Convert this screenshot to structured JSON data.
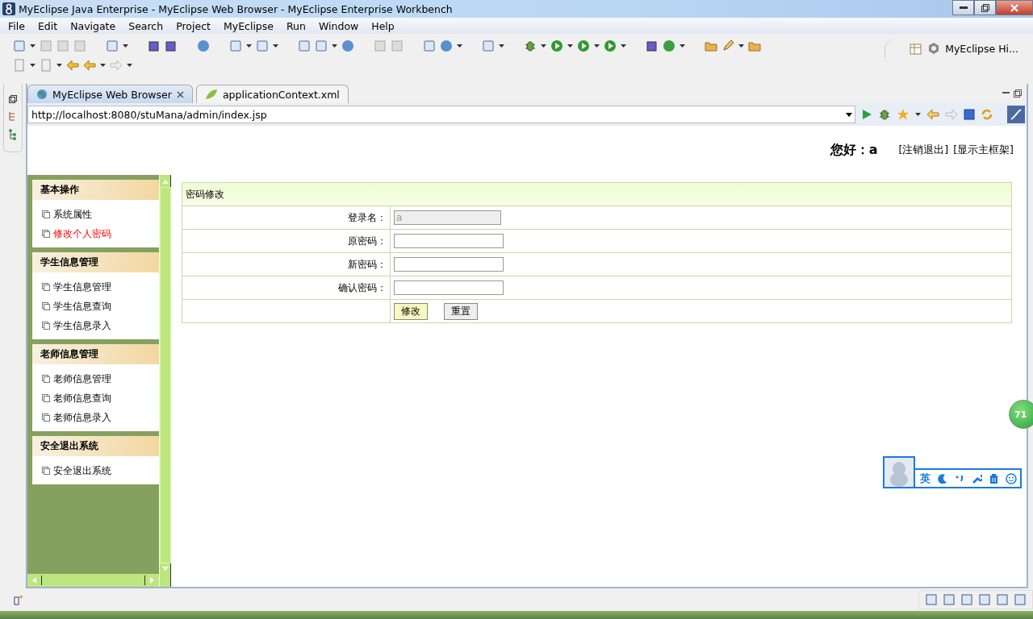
{
  "window": {
    "title": "MyEclipse Java Enterprise - MyEclipse Web Browser - MyEclipse Enterprise Workbench"
  },
  "menu": [
    "File",
    "Edit",
    "Navigate",
    "Search",
    "Project",
    "MyEclipse",
    "Run",
    "Window",
    "Help"
  ],
  "perspective": {
    "label": "MyEclipse Hi..."
  },
  "editor_tabs": [
    {
      "label": "MyEclipse Web Browser",
      "selected": true
    },
    {
      "label": "applicationContext.xml",
      "selected": false
    }
  ],
  "address": {
    "value": "http://localhost:8080/stuMana/admin/index.jsp"
  },
  "page": {
    "greeting": "您好：a",
    "links": [
      "[注销退出]",
      "[显示主框架]"
    ],
    "sidebar": [
      {
        "title": "基本操作",
        "items": [
          {
            "label": "系统属性",
            "selected": false
          },
          {
            "label": "修改个人密码",
            "selected": true
          }
        ]
      },
      {
        "title": "学生信息管理",
        "items": [
          {
            "label": "学生信息管理",
            "selected": false
          },
          {
            "label": "学生信息查询",
            "selected": false
          },
          {
            "label": "学生信息录入",
            "selected": false
          }
        ]
      },
      {
        "title": "老师信息管理",
        "items": [
          {
            "label": "老师信息管理",
            "selected": false
          },
          {
            "label": "老师信息查询",
            "selected": false
          },
          {
            "label": "老师信息录入",
            "selected": false
          }
        ]
      },
      {
        "title": "安全退出系统",
        "items": [
          {
            "label": "安全退出系统",
            "selected": false
          }
        ]
      }
    ],
    "form": {
      "title": "密码修改",
      "fields": [
        {
          "label": "登录名：",
          "value": "a",
          "disabled": true
        },
        {
          "label": "原密码：",
          "disabled": false
        },
        {
          "label": "新密码：",
          "disabled": false
        },
        {
          "label": "确认密码：",
          "disabled": false
        }
      ],
      "buttons": [
        {
          "label": "修改",
          "kind": "primary"
        },
        {
          "label": "重置",
          "kind": "normal"
        }
      ]
    }
  },
  "ime_bar": {
    "mode": "英"
  },
  "floating_badge": {
    "text": "71"
  }
}
